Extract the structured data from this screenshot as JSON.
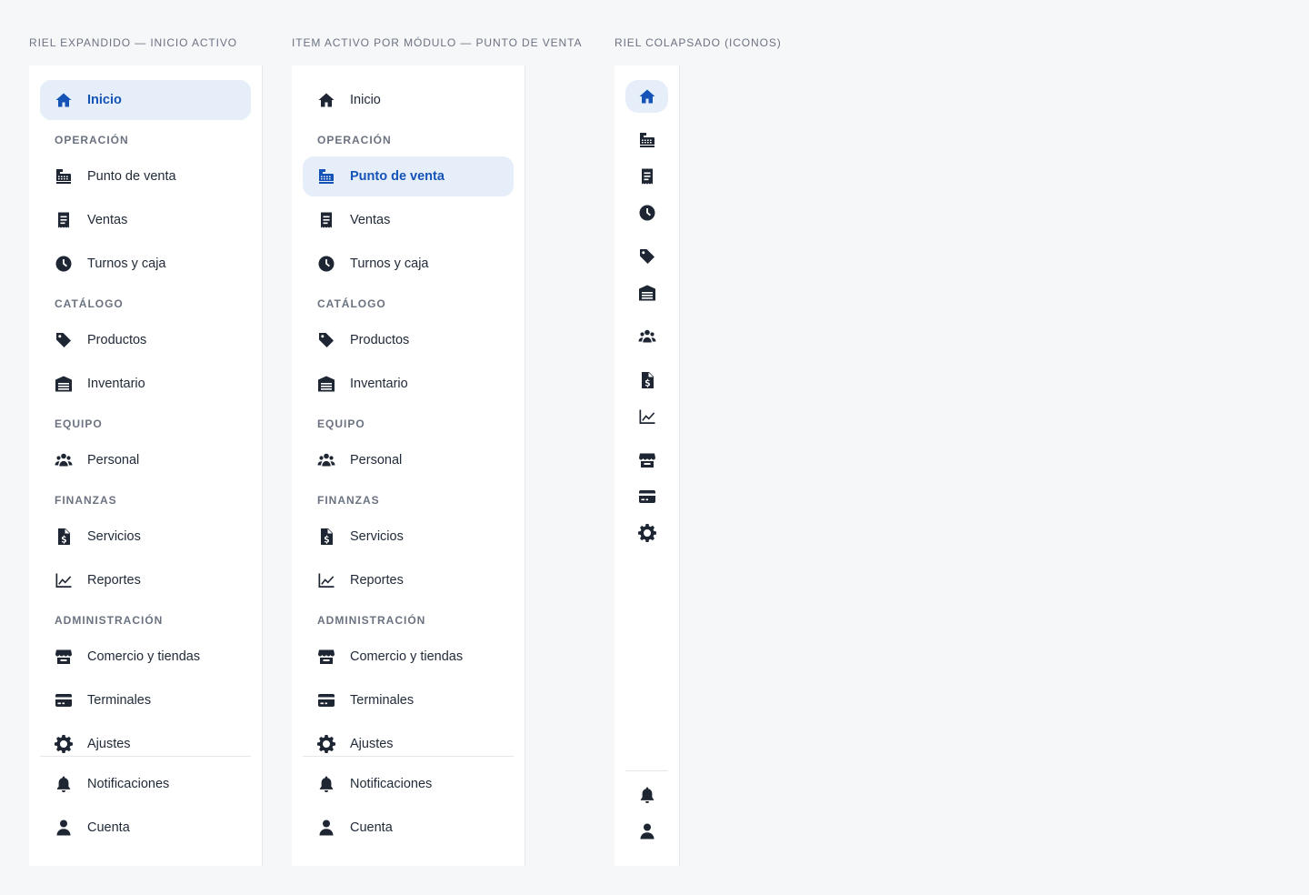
{
  "columns": [
    {
      "title": "RIEL EXPANDIDO — INICIO ACTIVO",
      "active": "inicio",
      "items": {
        "inicio": "Inicio",
        "punto_de_venta": "Punto de venta",
        "ventas": "Ventas",
        "turnos_y_caja": "Turnos y caja",
        "productos": "Productos",
        "inventario": "Inventario",
        "personal": "Personal",
        "servicios": "Servicios",
        "reportes": "Reportes",
        "comercio_y_tiendas": "Comercio y tiendas",
        "terminales": "Terminales",
        "ajustes": "Ajustes",
        "notificaciones": "Notificaciones",
        "cuenta": "Cuenta"
      },
      "sections": {
        "operacion": "OPERACIÓN",
        "catalogo": "CATÁLOGO",
        "equipo": "EQUIPO",
        "finanzas": "FINANZAS",
        "administracion": "ADMINISTRACIÓN"
      }
    },
    {
      "title": "ITEM ACTIVO POR MÓDULO — PUNTO DE VENTA",
      "active": "punto_de_venta",
      "items": {
        "inicio": "Inicio",
        "punto_de_venta": "Punto de venta",
        "ventas": "Ventas",
        "turnos_y_caja": "Turnos y caja",
        "productos": "Productos",
        "inventario": "Inventario",
        "personal": "Personal",
        "servicios": "Servicios",
        "reportes": "Reportes",
        "comercio_y_tiendas": "Comercio y tiendas",
        "terminales": "Terminales",
        "ajustes": "Ajustes",
        "notificaciones": "Notificaciones",
        "cuenta": "Cuenta"
      },
      "sections": {
        "operacion": "OPERACIÓN",
        "catalogo": "CATÁLOGO",
        "equipo": "EQUIPO",
        "finanzas": "FINANZAS",
        "administracion": "ADMINISTRACIÓN"
      }
    },
    {
      "title": "RIEL COLAPSADO (ICONOS)",
      "active": "inicio"
    }
  ],
  "icons": {
    "inicio": "home-icon",
    "punto_de_venta": "cash-register-icon",
    "ventas": "receipt-icon",
    "turnos_y_caja": "clock-icon",
    "productos": "tag-icon",
    "inventario": "warehouse-icon",
    "personal": "users-icon",
    "servicios": "invoice-dollar-icon",
    "reportes": "chart-line-icon",
    "comercio_y_tiendas": "store-icon",
    "terminales": "credit-card-icon",
    "ajustes": "gear-icon",
    "notificaciones": "bell-icon",
    "cuenta": "user-icon"
  },
  "colors": {
    "accent": "#1553b7",
    "active_bg": "#e6eef9",
    "icon": "#1e2633",
    "section_label": "#6b7280",
    "page_bg": "#f6f7f9"
  }
}
